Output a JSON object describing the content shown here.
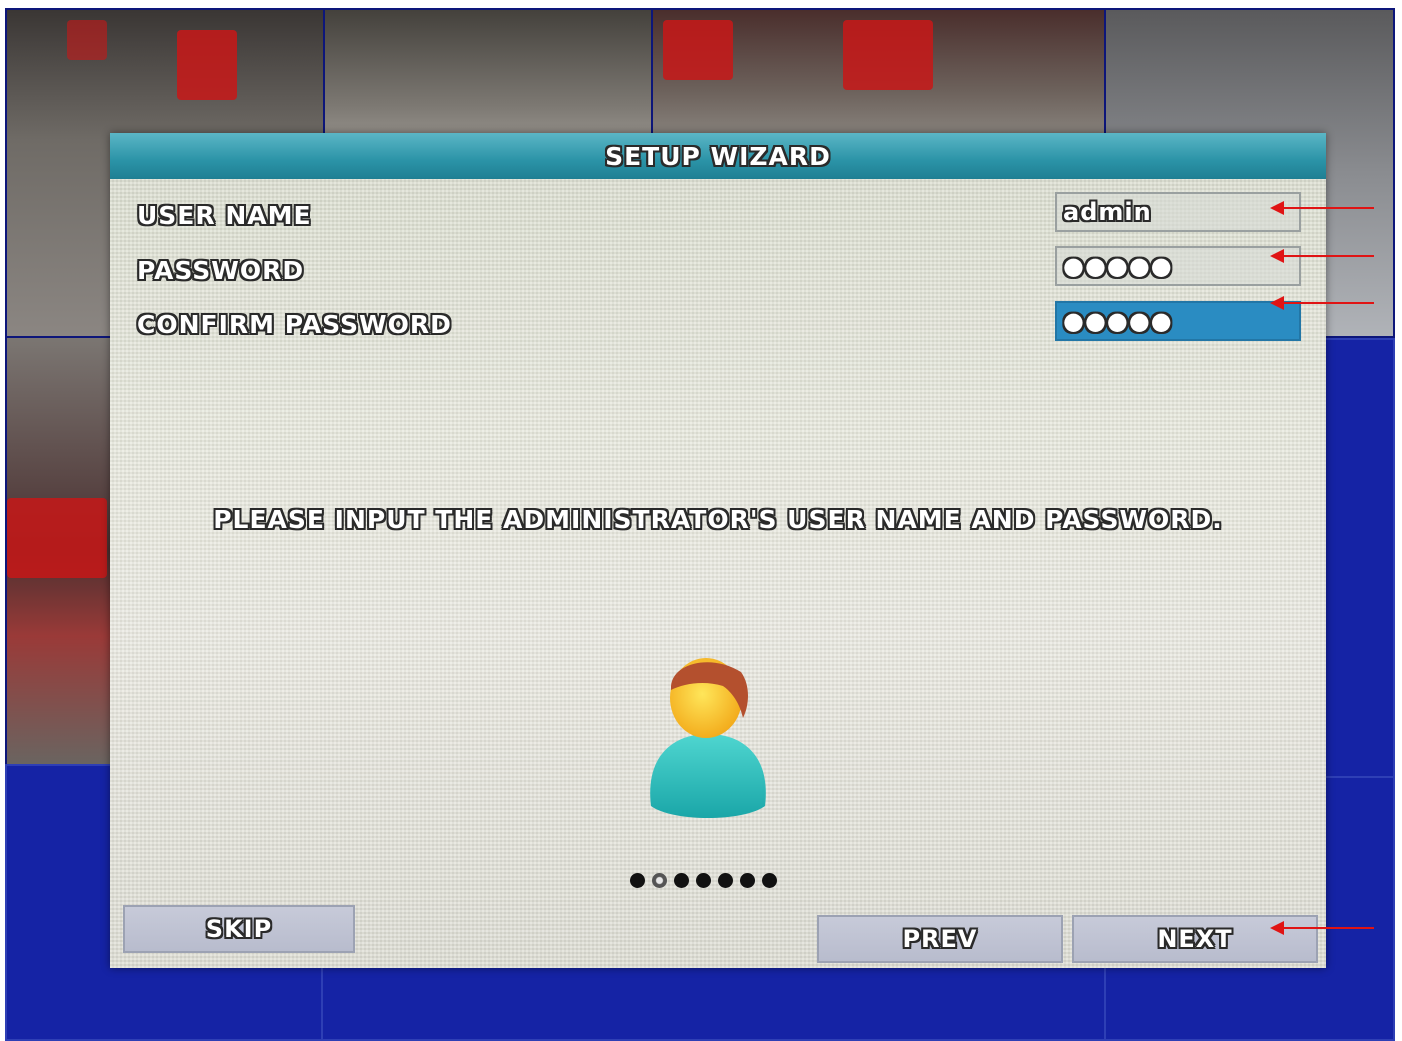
{
  "dialog": {
    "title": "SETUP WIZARD",
    "fields": [
      {
        "label": "USER NAME",
        "value": "admin"
      },
      {
        "label": "PASSWORD",
        "value": "●●●●●"
      },
      {
        "label": "CONFIRM PASSWORD",
        "value": "●●●●●"
      }
    ],
    "message": "PLEASE INPUT THE ADMINISTRATOR'S USER NAME AND PASSWORD.",
    "wizard_progress": {
      "total_steps": 7,
      "current_step": 2
    },
    "buttons": {
      "skip": "SKIP",
      "prev": "PREV",
      "next": "NEXT"
    }
  },
  "colors": {
    "title_bar": "#2b93a7",
    "active_field": "#2a8cc2",
    "annotation_arrow": "#e01414",
    "background_blue": "#14219a"
  },
  "icons": [
    "admin-user-avatar-icon",
    "annotation-arrow"
  ]
}
